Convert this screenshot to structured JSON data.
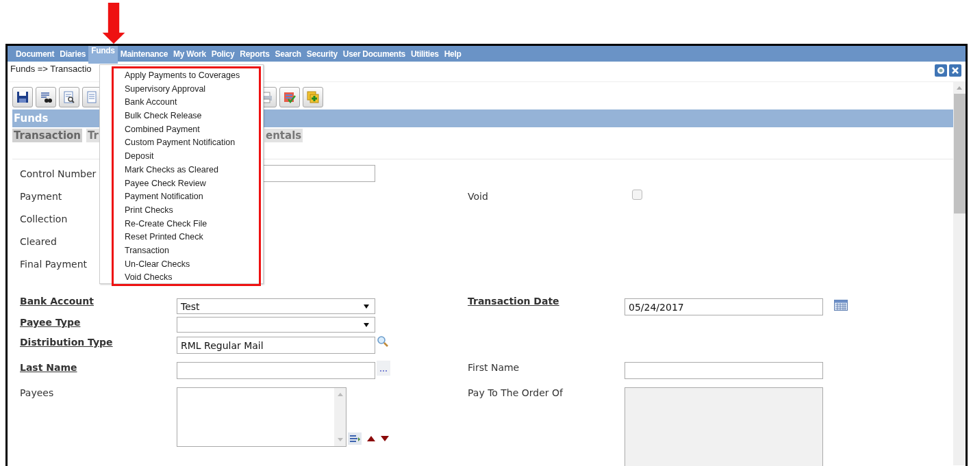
{
  "menu_bar": [
    {
      "label": "Document",
      "selected": false
    },
    {
      "label": "Diaries",
      "selected": false
    },
    {
      "label": "Funds",
      "selected": true
    },
    {
      "label": "Maintenance",
      "selected": false
    },
    {
      "label": "My Work",
      "selected": false
    },
    {
      "label": "Policy",
      "selected": false
    },
    {
      "label": "Reports",
      "selected": false
    },
    {
      "label": "Search",
      "selected": false
    },
    {
      "label": "Security",
      "selected": false
    },
    {
      "label": "User Documents",
      "selected": false
    },
    {
      "label": "Utilities",
      "selected": false
    },
    {
      "label": "Help",
      "selected": false
    }
  ],
  "breadcrumb": "Funds => Transactio",
  "section_title": "Funds",
  "tabs": [
    {
      "label": "Transaction",
      "selected": true
    },
    {
      "label": "Tr",
      "selected": false
    },
    {
      "label": "entals",
      "selected": false
    }
  ],
  "dropdown": {
    "items": [
      "Apply Payments to Coverages",
      "Supervisory Approval",
      "Bank Account",
      "Bulk Check Release",
      "Combined Payment",
      "Custom Payment Notification",
      "Deposit",
      "Mark Checks as Cleared",
      "Payee Check Review",
      "Payment Notification",
      "Print Checks",
      "Re-Create Check File",
      "Reset Printed Check",
      "Transaction",
      "Un-Clear Checks",
      "Void Checks"
    ]
  },
  "status_rows": [
    {
      "left": {
        "label": "Control Number",
        "kind": "text",
        "required": false
      }
    },
    {
      "left": {
        "label": "Payment",
        "kind": "none",
        "required": false
      },
      "right": {
        "label": "Void",
        "kind": "checkbox",
        "checked": false,
        "required": false
      }
    },
    {
      "left": {
        "label": "Collection",
        "kind": "none",
        "required": false
      }
    },
    {
      "left": {
        "label": "Cleared",
        "kind": "none",
        "required": false
      }
    },
    {
      "left": {
        "label": "Final Payment",
        "kind": "none",
        "required": false
      }
    }
  ],
  "detail_rows": [
    {
      "left": {
        "label": "Bank Account",
        "kind": "select",
        "value": "Test",
        "required": true
      },
      "right": {
        "label": "Transaction Date",
        "kind": "date",
        "value": "05/24/2017",
        "required": true
      }
    },
    {
      "left": {
        "label": "Payee Type",
        "kind": "select",
        "required": true
      }
    },
    {
      "left": {
        "label": "Distribution Type",
        "kind": "lookup",
        "value": "RML Regular Mail",
        "required": true
      }
    },
    {
      "left": {
        "label": "Last Name",
        "kind": "browse",
        "required": true
      },
      "right": {
        "label": "First Name",
        "kind": "text",
        "required": false
      }
    },
    {
      "left": {
        "label": "Payees",
        "kind": "list",
        "required": false
      },
      "right": {
        "label": "Pay To The Order Of",
        "kind": "readonly",
        "required": false
      }
    }
  ]
}
